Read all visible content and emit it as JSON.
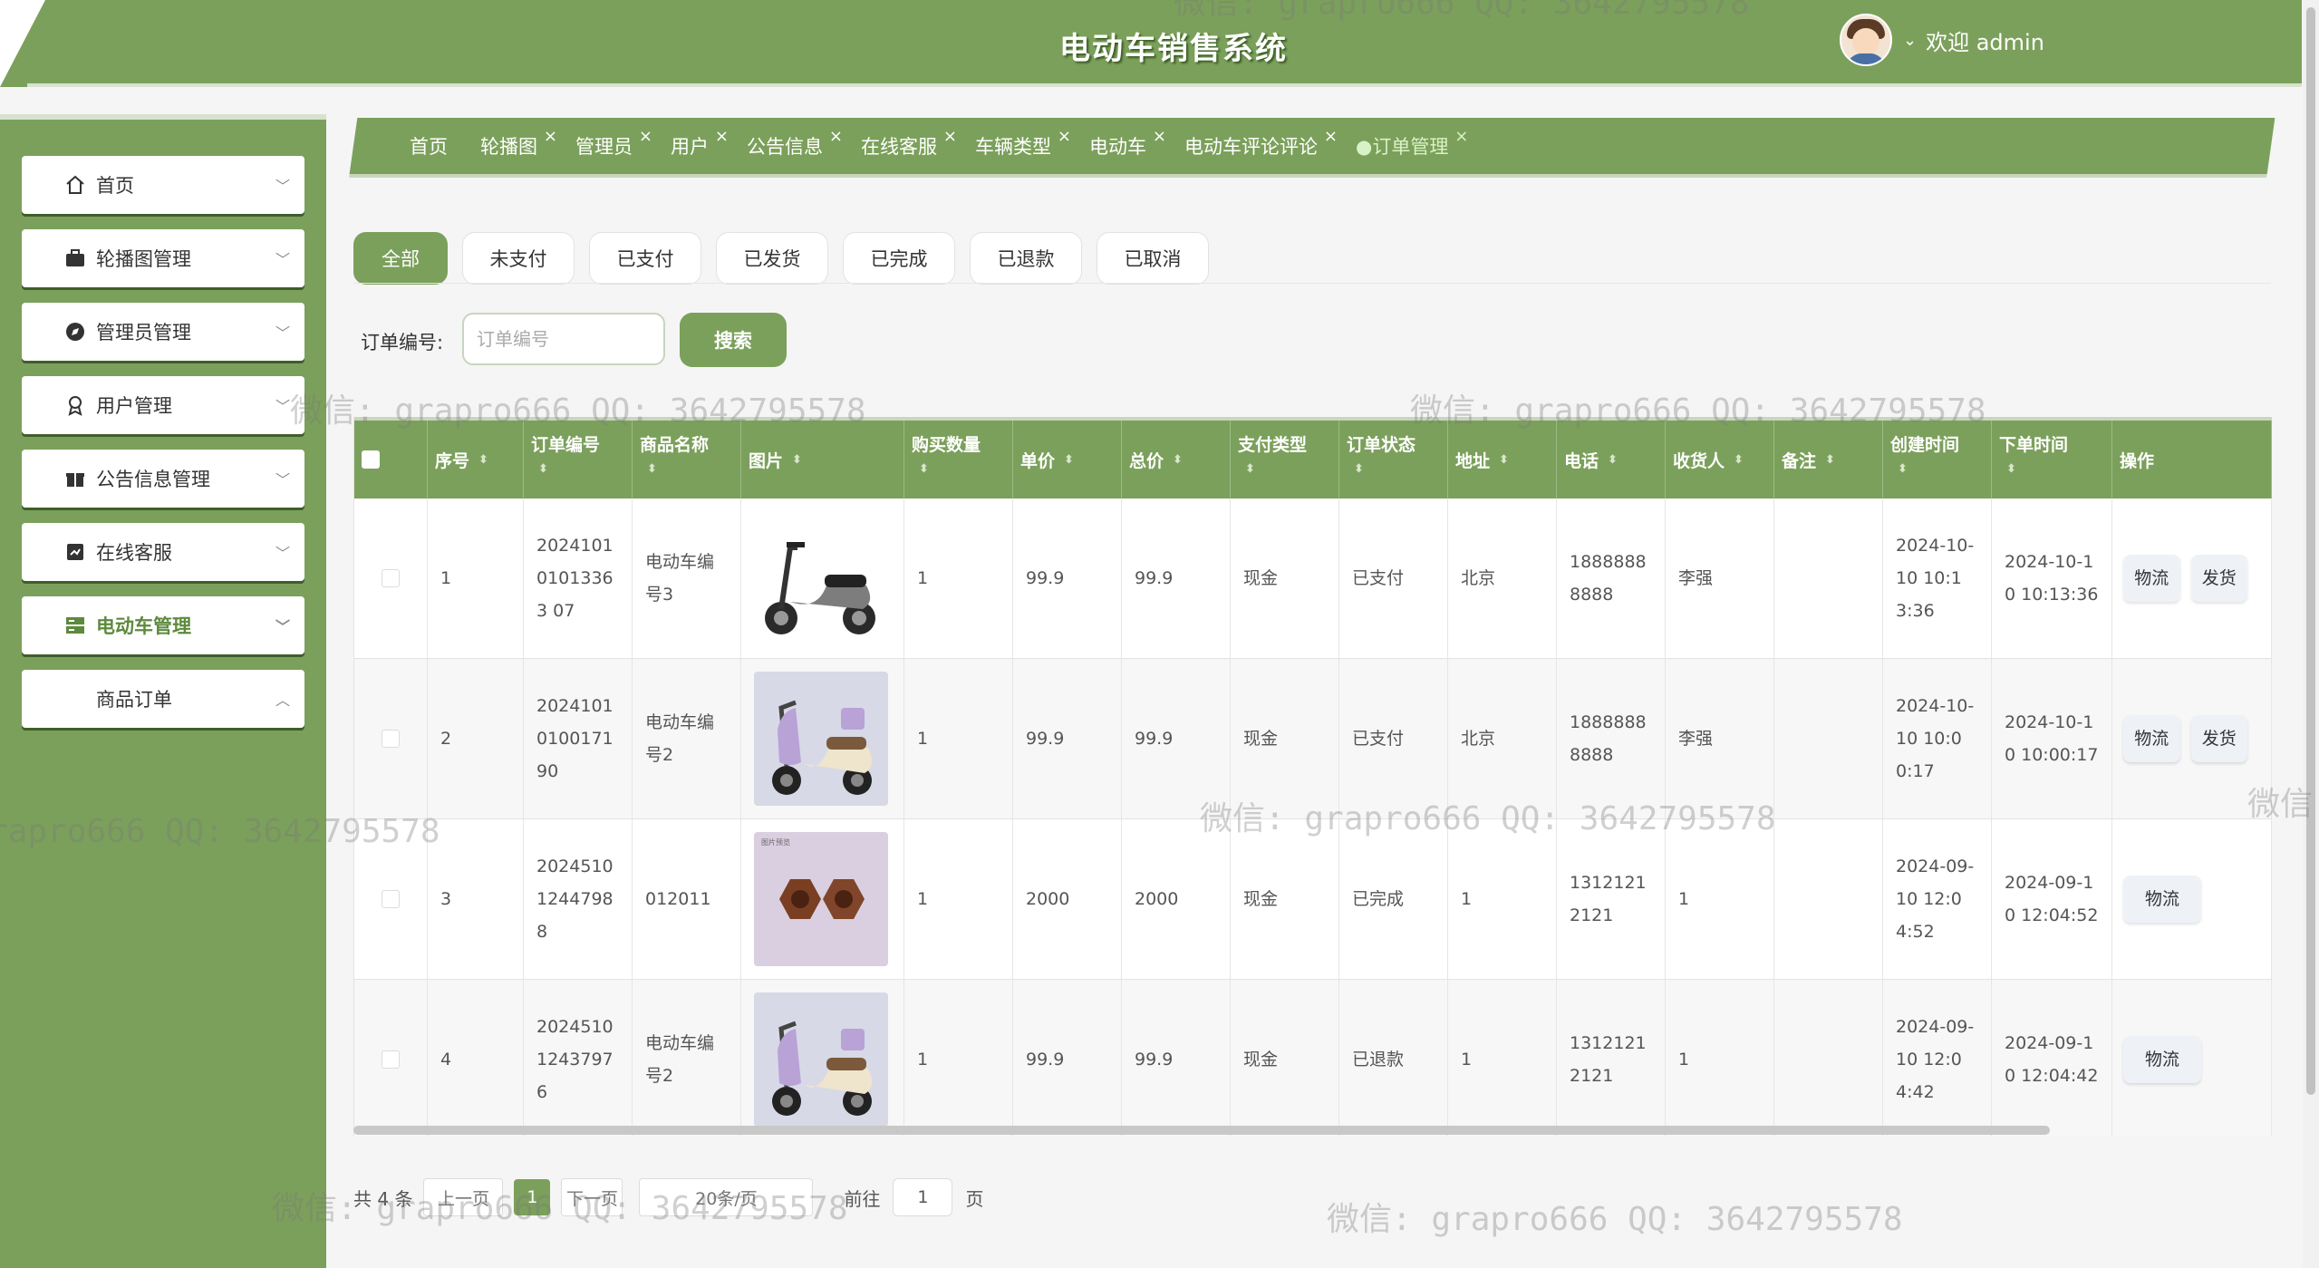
{
  "header": {
    "title": "电动车销售系统",
    "welcome": "欢迎 admin"
  },
  "sidebar": {
    "items": [
      {
        "label": "首页",
        "icon": "home-icon"
      },
      {
        "label": "轮播图管理",
        "icon": "briefcase-icon"
      },
      {
        "label": "管理员管理",
        "icon": "compass-icon"
      },
      {
        "label": "用户管理",
        "icon": "award-icon"
      },
      {
        "label": "公告信息管理",
        "icon": "gift-icon"
      },
      {
        "label": "在线客服",
        "icon": "chat-icon"
      },
      {
        "label": "电动车管理",
        "icon": "server-icon"
      },
      {
        "label": "商品订单",
        "icon": ""
      }
    ]
  },
  "tabs": [
    "首页",
    "轮播图",
    "管理员",
    "用户",
    "公告信息",
    "在线客服",
    "车辆类型",
    "电动车",
    "电动车评论评论",
    "●订单管理"
  ],
  "tab_close": "×",
  "status_filters": [
    "全部",
    "未支付",
    "已支付",
    "已发货",
    "已完成",
    "已退款",
    "已取消"
  ],
  "search": {
    "label": "订单编号:",
    "placeholder": "订单编号",
    "button": "搜索"
  },
  "table": {
    "columns": [
      "序号",
      "订单编号",
      "商品名称",
      "图片",
      "购买数量",
      "单价",
      "总价",
      "支付类型",
      "订单状态",
      "地址",
      "电话",
      "收货人",
      "备注",
      "创建时间",
      "下单时间",
      "操作"
    ],
    "rows": [
      {
        "no": "1",
        "order_no": "202410101013363 07",
        "name": "电动车编号3",
        "qty": "1",
        "price": "99.9",
        "total": "99.9",
        "pay": "现金",
        "status": "已支付",
        "addr": "北京",
        "phone": "18888888888",
        "receiver": "李强",
        "remark": "",
        "created": "2024-10-10 10:13:36",
        "ordered": "2024-10-10 10:13:36",
        "actions": [
          "物流",
          "发货"
        ],
        "img": "scooter-gray"
      },
      {
        "no": "2",
        "order_no": "2024101010017190",
        "name": "电动车编号2",
        "qty": "1",
        "price": "99.9",
        "total": "99.9",
        "pay": "现金",
        "status": "已支付",
        "addr": "北京",
        "phone": "18888888888",
        "receiver": "李强",
        "remark": "",
        "created": "2024-10-10 10:00:17",
        "ordered": "2024-10-10 10:00:17",
        "actions": [
          "物流",
          "发货"
        ],
        "img": "scooter-lilac"
      },
      {
        "no": "3",
        "order_no": "202451012447988",
        "name": "012011",
        "qty": "1",
        "price": "2000",
        "total": "2000",
        "pay": "现金",
        "status": "已完成",
        "addr": "1",
        "phone": "13121212121",
        "receiver": "1",
        "remark": "",
        "created": "2024-09-10 12:04:52",
        "ordered": "2024-09-10 12:04:52",
        "actions": [
          "物流"
        ],
        "img": "nuts"
      },
      {
        "no": "4",
        "order_no": "202451012437976",
        "name": "电动车编号2",
        "qty": "1",
        "price": "99.9",
        "total": "99.9",
        "pay": "现金",
        "status": "已退款",
        "addr": "1",
        "phone": "13121212121",
        "receiver": "1",
        "remark": "",
        "created": "2024-09-10 12:04:42",
        "ordered": "2024-09-10 12:04:42",
        "actions": [
          "物流"
        ],
        "img": "scooter-lilac"
      }
    ]
  },
  "pagination": {
    "total": "共 4 条",
    "prev": "上一页",
    "page": "1",
    "next": "下一页",
    "size": "20条/页",
    "goto_label": "前往",
    "goto_value": "1",
    "page_unit": "页"
  },
  "watermark": "微信: grapro666 QQ: 3642795578",
  "watermark_partial": "微信",
  "colors": {
    "primary": "#7ba05b",
    "header_text": "#ffffff"
  }
}
